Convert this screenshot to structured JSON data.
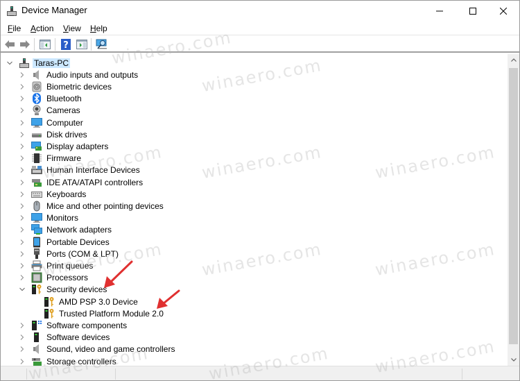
{
  "window": {
    "title": "Device Manager",
    "controls": {
      "minimize": "minimize",
      "maximize": "maximize",
      "close": "close"
    }
  },
  "menu": [
    {
      "label": "File",
      "accel": "F",
      "rest": "ile"
    },
    {
      "label": "Action",
      "accel": "A",
      "rest": "ction"
    },
    {
      "label": "View",
      "accel": "V",
      "rest": "iew"
    },
    {
      "label": "Help",
      "accel": "H",
      "rest": "elp"
    }
  ],
  "toolbar": {
    "buttons": [
      "back-icon",
      "forward-icon",
      "show-hide-console-tree-icon",
      "help-icon",
      "show-hide-action-pane-icon",
      "scan-hardware-changes-icon"
    ]
  },
  "tree": {
    "root": {
      "label": "Taras-PC",
      "icon": "computer-tower-icon",
      "expanded": true
    },
    "categories": [
      {
        "label": "Audio inputs and outputs",
        "icon": "speaker-icon",
        "expanded": false
      },
      {
        "label": "Biometric devices",
        "icon": "fingerprint-icon",
        "expanded": false
      },
      {
        "label": "Bluetooth",
        "icon": "bluetooth-icon",
        "expanded": false
      },
      {
        "label": "Cameras",
        "icon": "camera-icon",
        "expanded": false
      },
      {
        "label": "Computer",
        "icon": "monitor-icon",
        "expanded": false
      },
      {
        "label": "Disk drives",
        "icon": "disk-drive-icon",
        "expanded": false
      },
      {
        "label": "Display adapters",
        "icon": "display-adapter-icon",
        "expanded": false
      },
      {
        "label": "Firmware",
        "icon": "chip-icon",
        "expanded": false
      },
      {
        "label": "Human Interface Devices",
        "icon": "hid-icon",
        "expanded": false
      },
      {
        "label": "IDE ATA/ATAPI controllers",
        "icon": "ide-controller-icon",
        "expanded": false
      },
      {
        "label": "Keyboards",
        "icon": "keyboard-icon",
        "expanded": false
      },
      {
        "label": "Mice and other pointing devices",
        "icon": "mouse-icon",
        "expanded": false
      },
      {
        "label": "Monitors",
        "icon": "monitor-icon",
        "expanded": false
      },
      {
        "label": "Network adapters",
        "icon": "network-adapter-icon",
        "expanded": false
      },
      {
        "label": "Portable Devices",
        "icon": "portable-device-icon",
        "expanded": false
      },
      {
        "label": "Ports (COM & LPT)",
        "icon": "port-icon",
        "expanded": false
      },
      {
        "label": "Print queues",
        "icon": "printer-icon",
        "expanded": false
      },
      {
        "label": "Processors",
        "icon": "processor-icon",
        "expanded": false
      },
      {
        "label": "Security devices",
        "icon": "security-key-icon",
        "expanded": true,
        "children": [
          {
            "label": "AMD PSP 3.0 Device",
            "icon": "security-key-icon"
          },
          {
            "label": "Trusted Platform Module 2.0",
            "icon": "security-key-icon"
          }
        ]
      },
      {
        "label": "Software components",
        "icon": "software-component-icon",
        "expanded": false
      },
      {
        "label": "Software devices",
        "icon": "software-device-icon",
        "expanded": false
      },
      {
        "label": "Sound, video and game controllers",
        "icon": "speaker-icon",
        "expanded": false
      },
      {
        "label": "Storage controllers",
        "icon": "storage-controller-icon",
        "expanded": false
      }
    ]
  },
  "annotations": {
    "arrow_color": "#e03030",
    "arrows": [
      "points-to-security-devices",
      "points-to-trusted-platform-module"
    ]
  },
  "watermark": "winaero.com"
}
